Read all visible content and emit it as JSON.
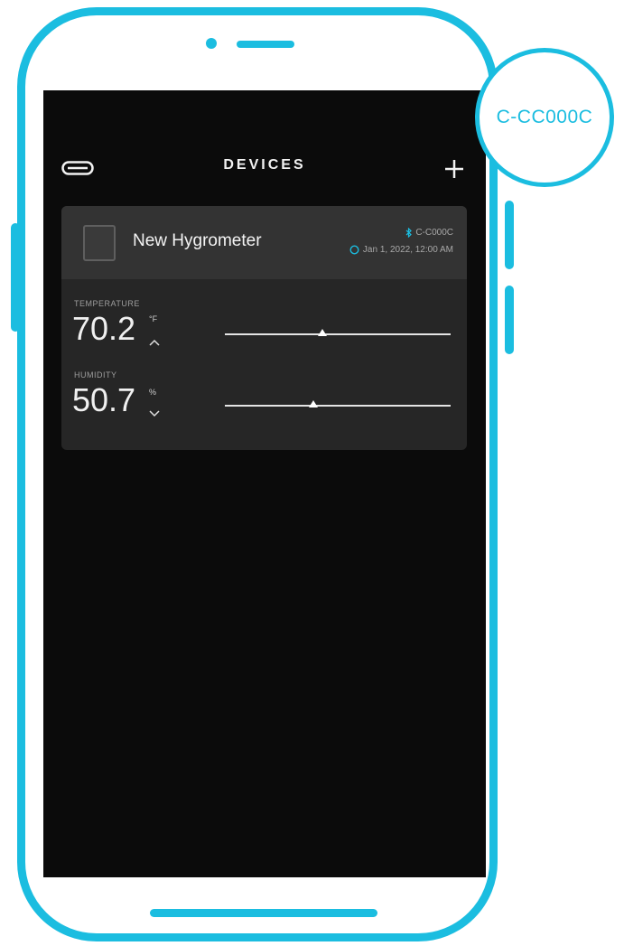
{
  "header": {
    "title": "DEVICES",
    "left_icon": "menu-icon",
    "right_icon": "plus-icon"
  },
  "device": {
    "name": "New Hygrometer",
    "id": "C-C000C",
    "timestamp": "Jan 1, 2022, 12:00 AM",
    "status_icons": [
      "bluetooth-icon",
      "sync-ring-icon"
    ],
    "temperature": {
      "label": "TEMPERATURE",
      "value": "70.2",
      "unit": "°F",
      "trend": "up",
      "range_position": 0.43
    },
    "humidity": {
      "label": "HUMIDITY",
      "value": "50.7",
      "unit": "%",
      "trend": "down",
      "range_position": 0.39
    }
  },
  "badge": {
    "code": "C-CC000C"
  },
  "colors": {
    "accent": "#1bbde0",
    "screen_bg": "#0b0b0b",
    "card_bg": "#262626",
    "card_header_bg": "#333333"
  }
}
